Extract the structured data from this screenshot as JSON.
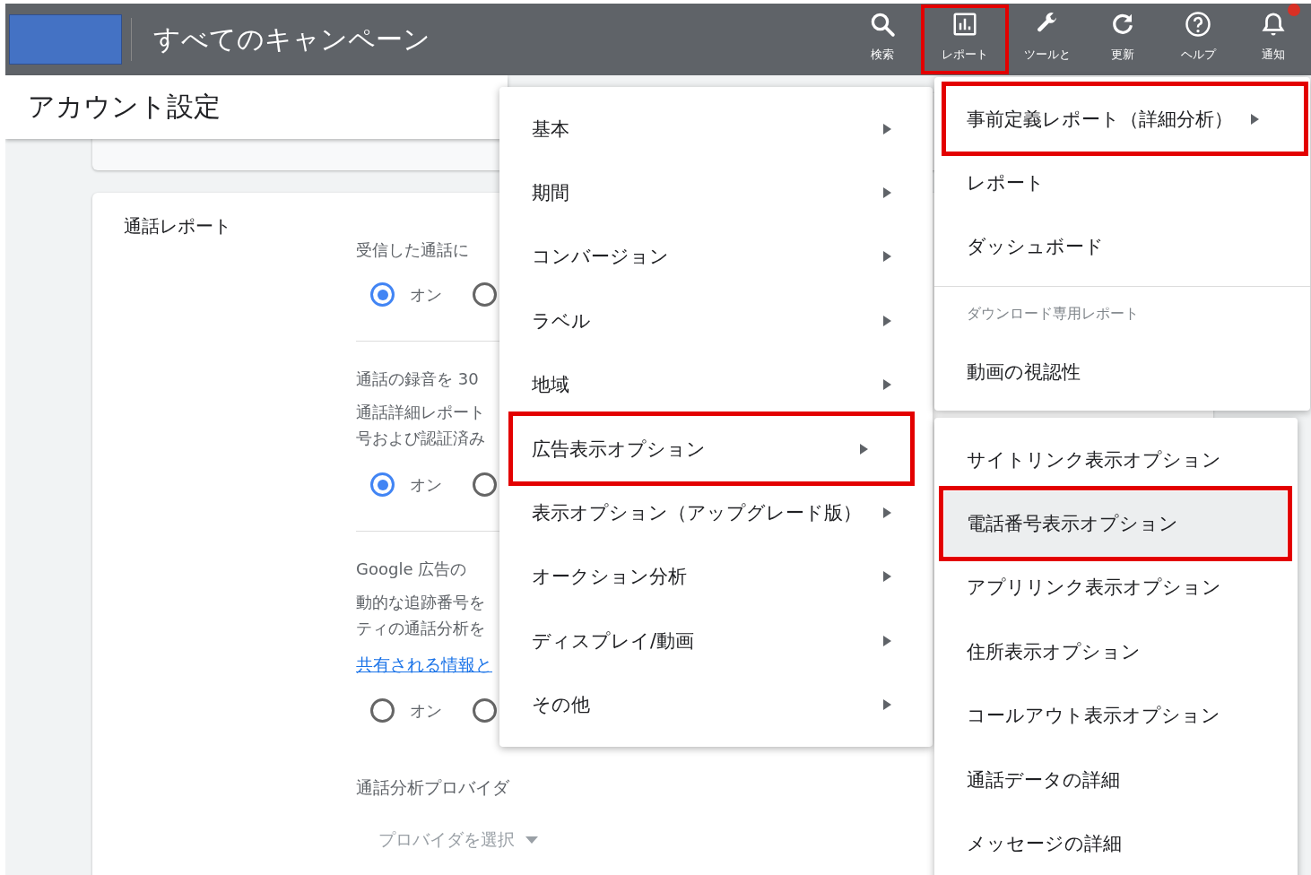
{
  "top_bar": {
    "title": "すべてのキャンペーン",
    "actions": [
      {
        "label": "検索",
        "highlighted": false
      },
      {
        "label": "レポート",
        "highlighted": true
      },
      {
        "label": "ツールと",
        "highlighted": false
      },
      {
        "label": "更新",
        "highlighted": false
      },
      {
        "label": "ヘルプ",
        "highlighted": false
      },
      {
        "label": "通知",
        "highlighted": false,
        "badge": true
      }
    ]
  },
  "page": {
    "title": "アカウント設定",
    "card": {
      "title": "通話レポート",
      "sections": [
        {
          "heading": "受信した通話に",
          "options": [
            {
              "label": "オン",
              "selected": true
            },
            {
              "selected": false
            }
          ]
        },
        {
          "heading": "通話の録音を 30",
          "description": [
            "通話詳細レポート",
            "号および認証済み"
          ],
          "options": [
            {
              "label": "オン",
              "selected": true
            },
            {
              "selected": false
            }
          ]
        },
        {
          "heading": "Google 広告の",
          "description": [
            "動的な追跡番号を",
            "ティの通話分析を"
          ],
          "link": "共有される情報と",
          "options": [
            {
              "label": "オン",
              "selected": false
            },
            {
              "selected": false
            }
          ]
        }
      ],
      "provider": {
        "label": "通話分析プロバイダ",
        "placeholder": "プロバイダを選択"
      }
    }
  },
  "menus": [
    {
      "items": [
        {
          "kind": "item",
          "label": "基本",
          "submenu": true,
          "highlighted": false,
          "selected": false
        },
        {
          "kind": "item",
          "label": "期間",
          "submenu": true,
          "highlighted": false,
          "selected": false
        },
        {
          "kind": "item",
          "label": "コンバージョン",
          "submenu": true,
          "highlighted": false,
          "selected": false
        },
        {
          "kind": "item",
          "label": "ラベル",
          "submenu": true,
          "highlighted": false,
          "selected": false
        },
        {
          "kind": "item",
          "label": "地域",
          "submenu": true,
          "highlighted": false,
          "selected": false
        },
        {
          "kind": "item",
          "label": "広告表示オプション",
          "submenu": true,
          "highlighted": true,
          "selected": false
        },
        {
          "kind": "item",
          "label": "表示オプション（アップグレード版）",
          "submenu": true,
          "highlighted": false,
          "selected": false
        },
        {
          "kind": "item",
          "label": "オークション分析",
          "submenu": true,
          "highlighted": false,
          "selected": false
        },
        {
          "kind": "item",
          "label": "ディスプレイ/動画",
          "submenu": true,
          "highlighted": false,
          "selected": false
        },
        {
          "kind": "item",
          "label": "その他",
          "submenu": true,
          "highlighted": false,
          "selected": false
        }
      ]
    },
    {
      "items": [
        {
          "kind": "item",
          "label": "事前定義レポート（詳細分析）",
          "submenu": true,
          "highlighted": true,
          "selected": false
        },
        {
          "kind": "item",
          "label": "レポート",
          "submenu": false,
          "highlighted": false,
          "selected": false
        },
        {
          "kind": "item",
          "label": "ダッシュボード",
          "submenu": false,
          "highlighted": false,
          "selected": false
        },
        {
          "kind": "divider"
        },
        {
          "kind": "header",
          "label": "ダウンロード専用レポート"
        },
        {
          "kind": "item",
          "label": "動画の視認性",
          "submenu": false,
          "highlighted": false,
          "selected": false
        }
      ]
    },
    {
      "items": [
        {
          "kind": "item",
          "label": "サイトリンク表示オプション",
          "submenu": false,
          "highlighted": false,
          "selected": false
        },
        {
          "kind": "item",
          "label": "電話番号表示オプション",
          "submenu": false,
          "highlighted": true,
          "selected": true
        },
        {
          "kind": "item",
          "label": "アプリリンク表示オプション",
          "submenu": false,
          "highlighted": false,
          "selected": false
        },
        {
          "kind": "item",
          "label": "住所表示オプション",
          "submenu": false,
          "highlighted": false,
          "selected": false
        },
        {
          "kind": "item",
          "label": "コールアウト表示オプション",
          "submenu": false,
          "highlighted": false,
          "selected": false
        },
        {
          "kind": "item",
          "label": "通話データの詳細",
          "submenu": false,
          "highlighted": false,
          "selected": false
        },
        {
          "kind": "item",
          "label": "メッセージの詳細",
          "submenu": false,
          "highlighted": false,
          "selected": false
        }
      ]
    }
  ]
}
